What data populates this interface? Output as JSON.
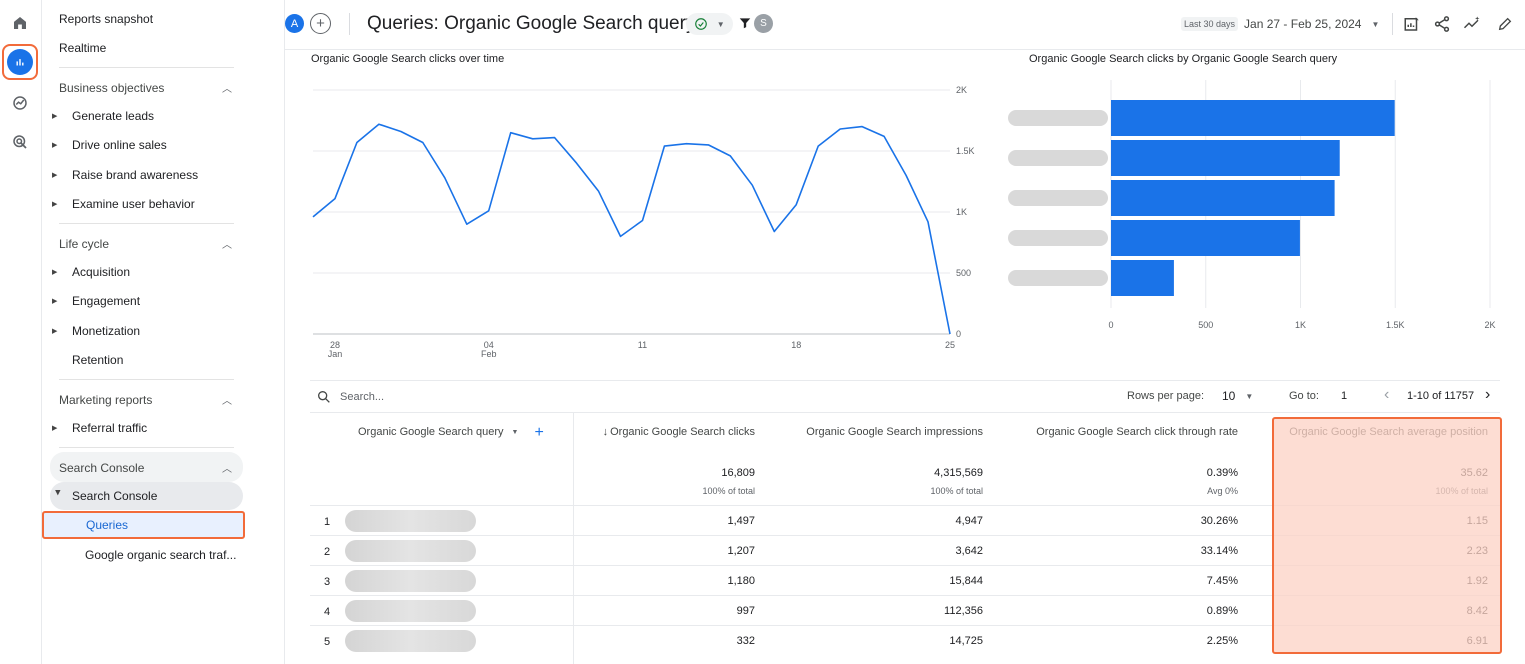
{
  "sidebar": {
    "top_items": [
      "Reports snapshot",
      "Realtime"
    ],
    "business_objectives": {
      "title": "Business objectives",
      "items": [
        "Generate leads",
        "Drive online sales",
        "Raise brand awareness",
        "Examine user behavior"
      ]
    },
    "life_cycle": {
      "title": "Life cycle",
      "items": [
        "Acquisition",
        "Engagement",
        "Monetization",
        "Retention"
      ]
    },
    "marketing_reports": {
      "title": "Marketing reports",
      "items": [
        "Referral traffic"
      ]
    },
    "search_console": {
      "title": "Search Console",
      "group": "Search Console",
      "items": [
        "Queries",
        "Google organic search traf..."
      ]
    }
  },
  "header": {
    "avatar_a": "A",
    "add_compare": "+",
    "title": "Queries: Organic Google Search query",
    "avatar_s": "S",
    "date_badge": "Last 30 days",
    "date_range": "Jan 27 - Feb 25, 2024"
  },
  "line_chart": {
    "title": "Organic Google Search clicks over time"
  },
  "bar_chart": {
    "title": "Organic Google Search clicks by Organic Google Search query"
  },
  "chart_data": [
    {
      "type": "line",
      "title": "Organic Google Search clicks over time",
      "x": [
        "Jan 27",
        "Jan 28",
        "Jan 29",
        "Jan 30",
        "Jan 31",
        "Feb 1",
        "Feb 2",
        "Feb 3",
        "Feb 4",
        "Feb 5",
        "Feb 6",
        "Feb 7",
        "Feb 8",
        "Feb 9",
        "Feb 10",
        "Feb 11",
        "Feb 12",
        "Feb 13",
        "Feb 14",
        "Feb 15",
        "Feb 16",
        "Feb 17",
        "Feb 18",
        "Feb 19",
        "Feb 20",
        "Feb 21",
        "Feb 22",
        "Feb 23",
        "Feb 24",
        "Feb 25"
      ],
      "x_tick_labels": [
        {
          "top": "28",
          "bottom": "Jan"
        },
        {
          "top": "04",
          "bottom": "Feb"
        },
        {
          "top": "11",
          "bottom": ""
        },
        {
          "top": "18",
          "bottom": ""
        },
        {
          "top": "25",
          "bottom": ""
        }
      ],
      "x_tick_index": [
        1,
        8,
        15,
        22,
        29
      ],
      "values": [
        960,
        1110,
        1570,
        1720,
        1660,
        1570,
        1280,
        900,
        1010,
        1650,
        1600,
        1610,
        1400,
        1170,
        800,
        930,
        1540,
        1560,
        1550,
        1460,
        1220,
        840,
        1060,
        1540,
        1680,
        1700,
        1620,
        1300,
        920,
        0
      ],
      "y_ticks": [
        0,
        500,
        1000,
        1500,
        2000
      ],
      "y_tick_labels": [
        "0",
        "500",
        "1K",
        "1.5K",
        "2K"
      ],
      "ylim": [
        0,
        2000
      ],
      "grid": true,
      "color": "#1a73e8"
    },
    {
      "type": "bar",
      "orientation": "horizontal",
      "title": "Organic Google Search clicks by Organic Google Search query",
      "values": [
        1497,
        1207,
        1180,
        997,
        332
      ],
      "x_ticks": [
        0,
        500,
        1000,
        1500,
        2000
      ],
      "x_tick_labels": [
        "0",
        "500",
        "1K",
        "1.5K",
        "2K"
      ],
      "xlim": [
        0,
        2000
      ],
      "grid": true,
      "color": "#1a73e8"
    }
  ],
  "table": {
    "search_placeholder": "Search...",
    "rows_per_page_label": "Rows per page:",
    "rows_per_page": "10",
    "goto_label": "Go to:",
    "goto_value": "1",
    "page_range": "1-10 of 11757",
    "dimension_header": "Organic Google Search query",
    "columns": [
      {
        "header": "Organic Google Search clicks",
        "total": "16,809",
        "sub": "100% of total"
      },
      {
        "header": "Organic Google Search impressions",
        "total": "4,315,569",
        "sub": "100% of total"
      },
      {
        "header": "Organic Google Search click through rate",
        "total": "0.39%",
        "sub": "Avg 0%"
      },
      {
        "header": "Organic Google Search average position",
        "total": "35.62",
        "sub": "100% of total"
      }
    ],
    "rows": [
      {
        "idx": "1",
        "clicks": "1,497",
        "impressions": "4,947",
        "ctr": "30.26%",
        "position": "1.15"
      },
      {
        "idx": "2",
        "clicks": "1,207",
        "impressions": "3,642",
        "ctr": "33.14%",
        "position": "2.23"
      },
      {
        "idx": "3",
        "clicks": "1,180",
        "impressions": "15,844",
        "ctr": "7.45%",
        "position": "1.92"
      },
      {
        "idx": "4",
        "clicks": "997",
        "impressions": "112,356",
        "ctr": "0.89%",
        "position": "8.42"
      },
      {
        "idx": "5",
        "clicks": "332",
        "impressions": "14,725",
        "ctr": "2.25%",
        "position": "6.91"
      }
    ]
  },
  "colors": {
    "accent": "#1a73e8",
    "highlight_border": "#f26b3a",
    "highlight_fill": "#fcd2c4"
  },
  "icons": [
    "home-icon",
    "reports-icon",
    "explore-icon",
    "advertising-icon",
    "checkmark-circle-icon",
    "filter-icon",
    "customize-report-icon",
    "share-icon",
    "insights-icon",
    "edit-icon",
    "search-icon",
    "sort-down-icon",
    "add-dimension-icon"
  ]
}
